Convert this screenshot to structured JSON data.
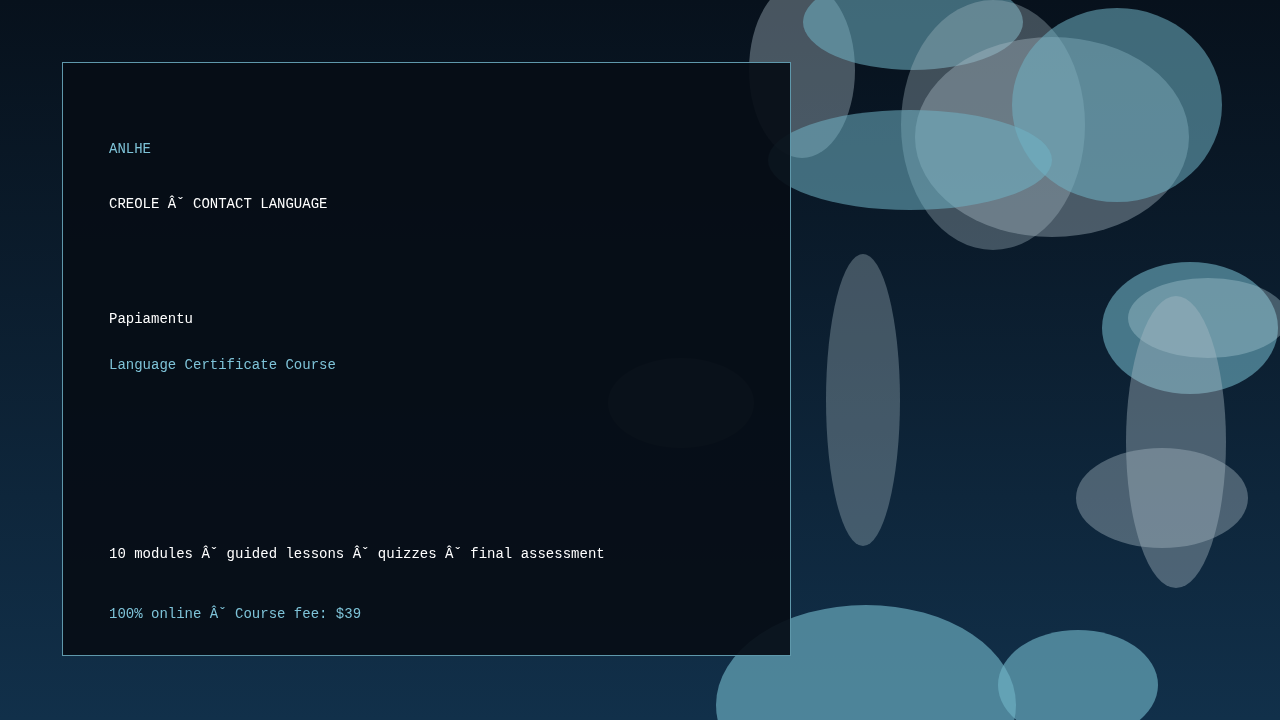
{
  "brand": "ANLHE",
  "category": "CREOLE Âˇ CONTACT LANGUAGE",
  "title": "Papiamentu",
  "subtitle": "Language Certificate Course",
  "features": "10 modules Âˇ guided lessons Âˇ quizzes Âˇ final assessment",
  "pricing": "100% online Âˇ Course fee: $39"
}
